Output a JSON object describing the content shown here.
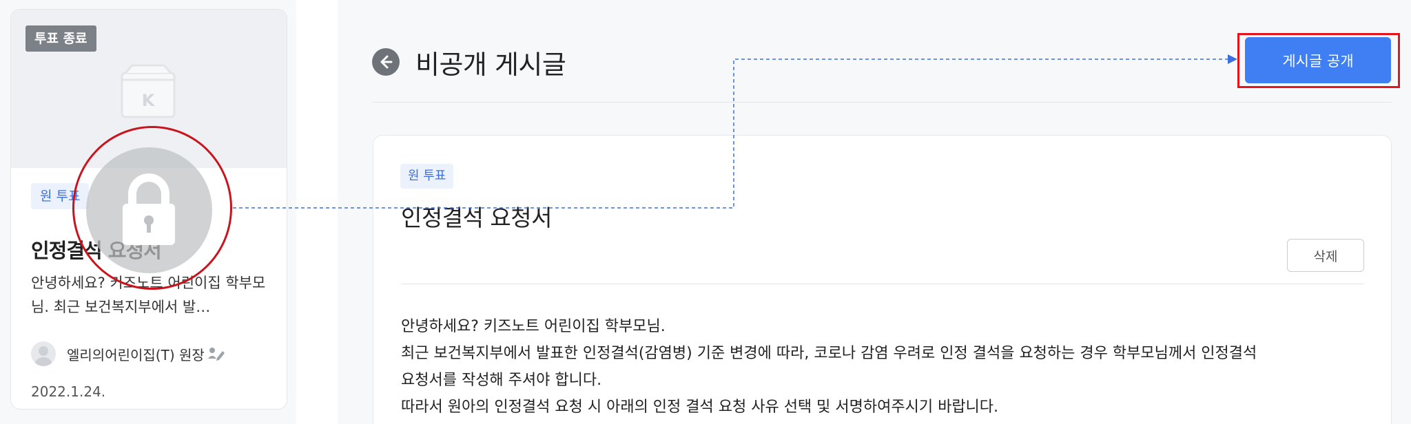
{
  "card": {
    "status_badge": "투표 종료",
    "tag": "원 투표",
    "title": "인정결석 요청서",
    "description": "안녕하세요? 키즈노트 어린이집 학부모님. 최근 보건복지부에서 발…",
    "author": "엘리의어린이집(T) 원장",
    "date": "2022.1.24."
  },
  "header": {
    "title": "비공개 게시글",
    "publish_label": "게시글 공개"
  },
  "post": {
    "tag": "원 투표",
    "title": "인정결석 요청서",
    "delete_label": "삭제",
    "body": [
      "안녕하세요? 키즈노트 어린이집 학부모님.",
      "최근 보건복지부에서 발표한 인정결석(감염병) 기준 변경에 따라, 코로나 감염 우려로 인정 결석을 요청하는 경우 학부모님께서 인정결석",
      "요청서를 작성해 주셔야 합니다.",
      "따라서 원아의 인정결석 요청 시 아래의 인정 결석 요청 사유 선택 및 서명하여주시기 바랍니다."
    ]
  },
  "colors": {
    "accent": "#3f7ff3",
    "annotation_red": "#e3141c",
    "connector_blue": "#3b6fe0",
    "badge_gray": "#7c8087"
  },
  "icons": {
    "lock": "lock-icon",
    "back": "back-arrow-icon",
    "box": "kidsnote-box-icon",
    "avatar": "user-avatar-icon",
    "pen": "pen-icon"
  }
}
